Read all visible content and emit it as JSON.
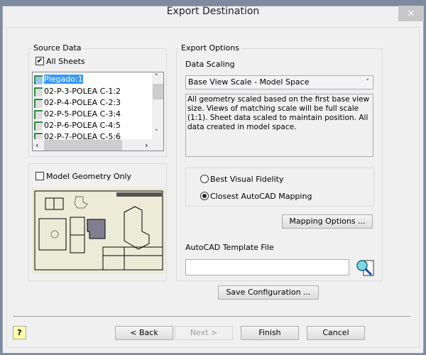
{
  "window": {
    "title": "Export Destination",
    "close": "×"
  },
  "source_data": {
    "legend": "Source Data",
    "all_sheets_label": "All Sheets",
    "all_sheets_checked": true,
    "sheets": [
      "Plegado:1",
      "02-P-3-POLEA C-1:2",
      "02-P-4-POLEA C-2:3",
      "02-P-5-POLEA C-3:4",
      "02-P-6-POLEA C-4:5",
      "02-P-7-POLEA C-5:6"
    ],
    "selected_index": 0
  },
  "model_geometry": {
    "label": "Model Geometry Only",
    "checked": false
  },
  "export_options": {
    "legend": "Export Options",
    "data_scaling_label": "Data Scaling",
    "data_scaling_value": "Base View Scale - Model Space",
    "description": "All geometry scaled based on the first base view size. Views of matching scale will be full scale (1:1). Sheet data scaled to maintain position. All data created in model space.",
    "radio_best": "Best Visual Fidelity",
    "radio_closest": "Closest AutoCAD Mapping",
    "selected_radio": "Closest AutoCAD Mapping",
    "mapping_button": "Mapping Options ...",
    "template_label": "AutoCAD Template File",
    "template_value": ""
  },
  "save_config": "Save Configuration ...",
  "footer": {
    "help": "?",
    "back": "< Back",
    "next": "Next >",
    "finish": "Finish",
    "cancel": "Cancel"
  },
  "colors": {
    "selection": "#3399ff",
    "sheet_icon": "#2e8b3e",
    "preview_bg": "#ecebd8"
  }
}
